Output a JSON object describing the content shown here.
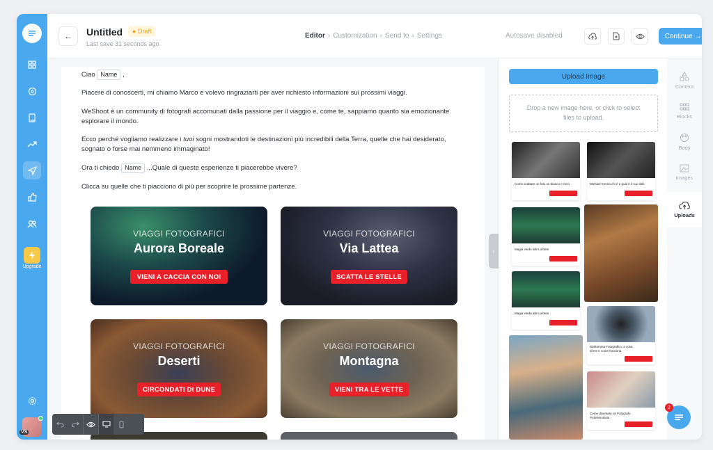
{
  "header": {
    "title": "Untitled",
    "status": "Draft",
    "last_save": "Last save 31 seconds ago",
    "steps": [
      "Editor",
      "Customization",
      "Send to",
      "Settings"
    ],
    "autosave": "Autosave disabled",
    "continue_label": "Continue"
  },
  "rail": {
    "upgrade_label": "Upgrade",
    "avatar_initials": "VS"
  },
  "email": {
    "greeting": "Ciao",
    "name_tag": "Name",
    "p1": "Piacere di conoscerti, mi chiamo Marco e volevo ringraziarti per aver richiesto informazioni sui prossimi viaggi.",
    "p2": "WeShoot è un community di fotografi accomunati dalla passione per il viaggio e, come te, sappiamo quanto sia emozionante esplorare il mondo.",
    "p3_a": "Ecco perché vogliamo realizzare i ",
    "p3_em": "tuoi",
    "p3_b": " sogni mostrandoti le destinazioni più incredibili della Terra, quelle che hai desiderato, sognato o forse mai nemmeno immaginato!",
    "p4_a": "Ora ti chiedo",
    "p4_b": "...Quale di queste esperienze ti piacerebbe vivere?",
    "p5": "Clicca su quelle che ti piacciono di più per scoprire le prossime partenze.",
    "cards": [
      {
        "sub": "VIAGGI FOTOGRAFICI",
        "title": "Aurora Boreale",
        "cta": "VIENI A CACCIA CON NOI"
      },
      {
        "sub": "VIAGGI FOTOGRAFICI",
        "title": "Via Lattea",
        "cta": "SCATTA LE STELLE"
      },
      {
        "sub": "VIAGGI FOTOGRAFICI",
        "title": "Deserti",
        "cta": "CIRCONDATI DI DUNE"
      },
      {
        "sub": "VIAGGI FOTOGRAFICI",
        "title": "Montagna",
        "cta": "VIENI TRA LE VETTE"
      }
    ]
  },
  "panel": {
    "upload_label": "Upload Image",
    "drop_line1": "Drop a new image here, or click to select",
    "drop_line2": "files to upload.",
    "captions": [
      "Come scattare un foto un bianco e nero",
      "Michael Kenna chi è e qual è il suo stile",
      "Magia verde alle Lofoten",
      "Magia verde alle Lofoten",
      "Diaframma Fotografico: a cosa serve e come funziona",
      "Come diventare un Fotografo Professionista"
    ]
  },
  "sidetabs": [
    "Content",
    "Blocks",
    "Body",
    "Images",
    "Uploads"
  ],
  "chat": {
    "badge": "2"
  }
}
